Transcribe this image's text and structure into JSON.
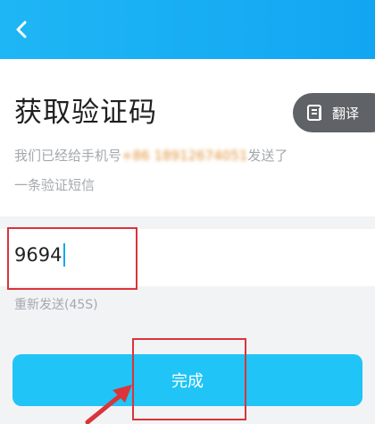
{
  "header": {
    "back_icon": "chevron-left-icon"
  },
  "page": {
    "title": "获取验证码",
    "subtitle_prefix": "我们已经给手机号",
    "phone_masked": "+86 18912674051",
    "subtitle_suffix": "发送了一条验证短信"
  },
  "translate": {
    "label": "翻译",
    "icon": "translate-icon"
  },
  "code_input": {
    "value": "9694"
  },
  "resend": {
    "label": "重新发送(45S)"
  },
  "done_button": {
    "label": "完成"
  },
  "colors": {
    "header_gradient_start": "#1fb6f5",
    "header_gradient_end": "#12a6f2",
    "primary_button": "#20c4f6",
    "annotation_red": "#d9353b",
    "translate_bg": "#5f6266"
  }
}
